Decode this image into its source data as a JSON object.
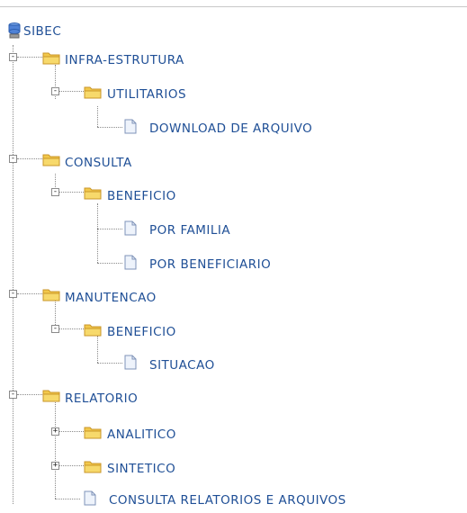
{
  "tree": {
    "root": {
      "label": "SIBEC",
      "icon": "database-icon"
    },
    "infra": {
      "label": "INFRA-ESTRUTURA",
      "toggle": "-",
      "utilitarios": {
        "label": "UTILITARIOS",
        "toggle": "-",
        "download": {
          "label": "DOWNLOAD DE ARQUIVO"
        }
      }
    },
    "consulta": {
      "label": "CONSULTA",
      "toggle": "-",
      "beneficio": {
        "label": "BENEFICIO",
        "toggle": "-",
        "por_familia": {
          "label": "POR FAMILIA"
        },
        "por_beneficiario": {
          "label": "POR BENEFICIARIO"
        }
      }
    },
    "manutencao": {
      "label": "MANUTENCAO",
      "toggle": "-",
      "beneficio": {
        "label": "BENEFICIO",
        "toggle": "-",
        "situacao": {
          "label": "SITUACAO"
        }
      }
    },
    "relatorio": {
      "label": "RELATORIO",
      "toggle": "-",
      "analitico": {
        "label": "ANALITICO",
        "toggle": "+"
      },
      "sintetico": {
        "label": "SINTETICO",
        "toggle": "+"
      },
      "consulta_relatorios": {
        "label": "CONSULTA RELATORIOS E ARQUIVOS"
      }
    }
  },
  "colors": {
    "link": "#1f4f96",
    "folder": "#f2c84b",
    "connector": "#8a8a8a"
  }
}
